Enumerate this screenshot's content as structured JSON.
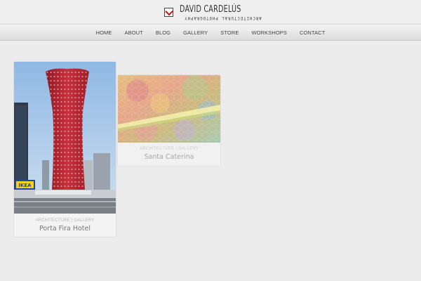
{
  "header": {
    "logo_name": "DAVID CARDELÚS",
    "logo_sub": "ARCHITECTURAL PHOTOGRAPHY"
  },
  "nav": {
    "items": [
      "HOME",
      "ABOUT",
      "BLOG",
      "GALLERY",
      "STORE",
      "WORKSHOPS",
      "CONTACT"
    ]
  },
  "posts": [
    {
      "category": "ARCHITECTURE | GALLERY",
      "title": "Porta Fira Hotel",
      "sign_text": "IKEA"
    },
    {
      "category": "ARCHITECTURE | GALLERY",
      "title": "Santa Caterina"
    }
  ],
  "colors": {
    "background": "#ececec",
    "tower_red": "#c02a35",
    "logo_accent": "#c01818"
  }
}
